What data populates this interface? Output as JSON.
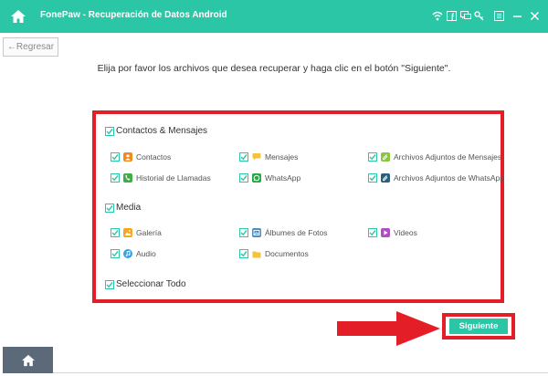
{
  "app": {
    "title": "FonePaw - Recuperación de Datos Android"
  },
  "nav": {
    "back_label": "←Regresar"
  },
  "instruction": "Elija por favor los archivos que desea recuperar y haga clic en el botón \"Siguiente\".",
  "groups": {
    "contacts": {
      "label": "Contactos & Mensajes",
      "checked": true,
      "items": [
        {
          "label": "Contactos",
          "icon": "contacts-icon",
          "color": "#f08c1e",
          "checked": true
        },
        {
          "label": "Mensajes",
          "icon": "messages-icon",
          "color": "#f5c23c",
          "checked": true
        },
        {
          "label": "Archivos Adjuntos de Mensajes",
          "icon": "message-attachments-icon",
          "color": "#8cc63f",
          "checked": true
        },
        {
          "label": "Historial de Llamadas",
          "icon": "call-history-icon",
          "color": "#3fae49",
          "checked": true
        },
        {
          "label": "WhatsApp",
          "icon": "whatsapp-icon",
          "color": "#27a745",
          "checked": true
        },
        {
          "label": "Archivos Adjuntos de WhatsApp",
          "icon": "whatsapp-attachments-icon",
          "color": "#2c5f7a",
          "checked": true
        }
      ]
    },
    "media": {
      "label": "Media",
      "checked": true,
      "items": [
        {
          "label": "Galería",
          "icon": "gallery-icon",
          "color": "#f5a623",
          "checked": true
        },
        {
          "label": "Álbumes de Fotos",
          "icon": "photo-albums-icon",
          "color": "#4a90c2",
          "checked": true
        },
        {
          "label": "Videos",
          "icon": "videos-icon",
          "color": "#b04fc4",
          "checked": true
        },
        {
          "label": "Audio",
          "icon": "audio-icon",
          "color": "#3aa0e0",
          "checked": true
        },
        {
          "label": "Documentos",
          "icon": "documents-icon",
          "color": "#f5c23c",
          "checked": true
        }
      ]
    }
  },
  "select_all": {
    "label": "Seleccionar Todo",
    "checked": true
  },
  "actions": {
    "next_label": "Siguiente"
  },
  "colors": {
    "accent": "#2bc6a5",
    "highlight": "#e41e26",
    "footer": "#5c6978"
  },
  "titlebar_icons": [
    "wifi-icon",
    "facebook-icon",
    "feedback-icon",
    "key-icon",
    "menu-icon",
    "minimize-icon",
    "close-icon"
  ]
}
